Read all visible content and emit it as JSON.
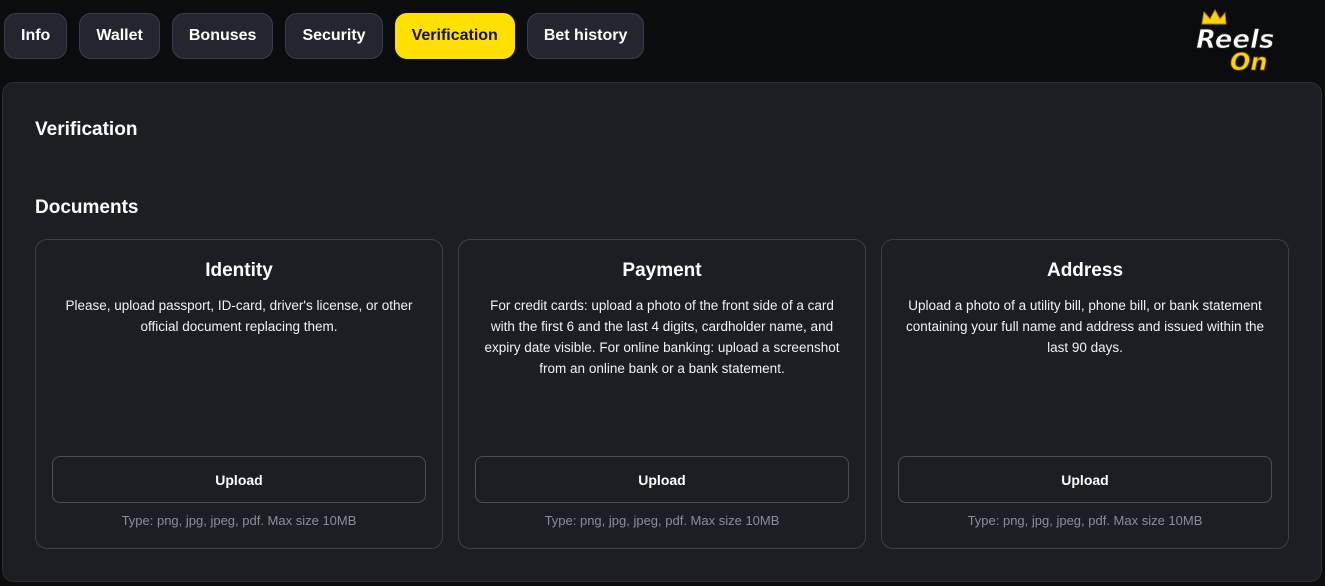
{
  "tabs": [
    {
      "label": "Info"
    },
    {
      "label": "Wallet"
    },
    {
      "label": "Bonuses"
    },
    {
      "label": "Security"
    },
    {
      "label": "Verification",
      "active": true
    },
    {
      "label": "Bet history"
    }
  ],
  "logo": {
    "line1": "Reels",
    "line2": "On"
  },
  "panel": {
    "title": "Verification",
    "section_title": "Documents"
  },
  "cards": [
    {
      "title": "Identity",
      "description": "Please, upload passport, ID-card, driver's license, or other official document replacing them.",
      "button": "Upload",
      "note": "Type: png, jpg, jpeg, pdf. Max size 10MB"
    },
    {
      "title": "Payment",
      "description": "For credit cards: upload a photo of the front side of a card with the first 6 and the last 4 digits, cardholder name, and expiry date visible. For online banking: upload a screenshot from an online bank or a bank statement.",
      "button": "Upload",
      "note": "Type: png, jpg, jpeg, pdf. Max size 10MB"
    },
    {
      "title": "Address",
      "description": "Upload a photo of a utility bill, phone bill, or bank statement containing your full name and address and issued within the last 90 days.",
      "button": "Upload",
      "note": "Type: png, jpg, jpeg, pdf. Max size 10MB"
    }
  ],
  "colors": {
    "accent": "#ffe000",
    "background": "#0b0c0e",
    "panel": "#1c1e24",
    "tab": "#23262f"
  }
}
